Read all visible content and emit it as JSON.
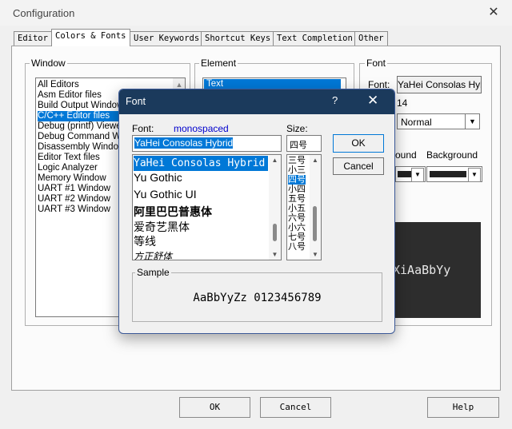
{
  "config": {
    "title": "Configuration",
    "tabs": [
      "Editor",
      "Colors & Fonts",
      "User Keywords",
      "Shortcut Keys",
      "Text Completion",
      "Other"
    ],
    "window_group": {
      "label": "Window",
      "items": [
        "All Editors",
        "Asm Editor files",
        "Build Output Window",
        "C/C++ Editor files",
        "Debug (printf) Viewer",
        "Debug Command Win",
        "Disassembly Window",
        "Editor Text files",
        "Logic Analyzer",
        "Memory Window",
        "UART #1 Window",
        "UART #2 Window",
        "UART #3 Window"
      ],
      "selected": "C/C++ Editor files"
    },
    "element_group": {
      "label": "Element",
      "items": [
        "Text"
      ],
      "selected": "Text"
    },
    "font_group": {
      "label": "Font",
      "font_label": "Font:",
      "font_value": "YaHei Consolas Hybri",
      "size_value": "14",
      "style_value": "Normal",
      "foreground_label": "ound",
      "background_label": "Background"
    },
    "preview_text": "XiAaBbYy",
    "buttons": {
      "ok": "OK",
      "cancel": "Cancel",
      "help": "Help"
    }
  },
  "font_dialog": {
    "title": "Font",
    "help_icon": "?",
    "font_label": "Font:",
    "font_type_hint": "monospaced",
    "font_input_value": "YaHei Consolas Hybrid",
    "font_list": [
      "YaHei Consolas Hybrid",
      "Yu Gothic",
      "Yu Gothic UI",
      "阿里巴巴普惠体",
      "爱奇艺黑体",
      "等线",
      "方正舒体"
    ],
    "selected_font": "YaHei Consolas Hybrid",
    "size_label": "Size:",
    "size_input_value": "四号",
    "size_list": [
      "三号",
      "小三",
      "四号",
      "小四",
      "五号",
      "小五",
      "六号",
      "小六",
      "七号",
      "八号"
    ],
    "selected_size": "四号",
    "ok_label": "OK",
    "cancel_label": "Cancel",
    "sample_label": "Sample",
    "sample_text": "AaBbYyZz 0123456789"
  },
  "colors": {
    "selection": "#0078d7",
    "dialog_title_bg": "#1b3a5c",
    "preview_bg": "#2d2d2d",
    "hint_blue": "#0000cc"
  }
}
